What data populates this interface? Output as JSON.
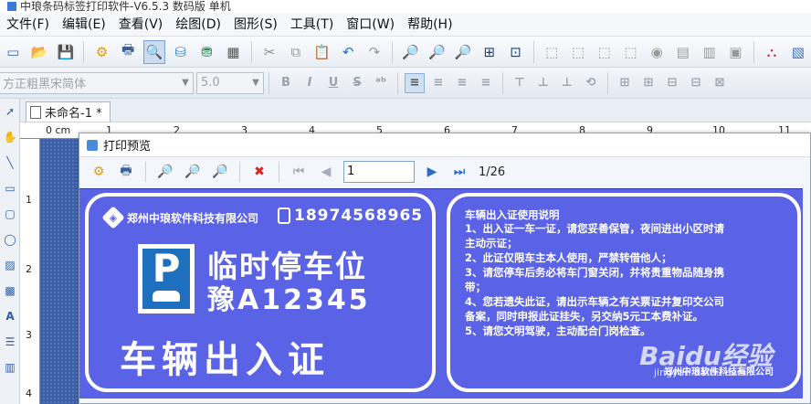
{
  "window": {
    "title": "中琅条码标签打印软件-V6.5.3 数码版 单机"
  },
  "menu": [
    {
      "label": "文件(F)"
    },
    {
      "label": "编辑(E)"
    },
    {
      "label": "查看(V)"
    },
    {
      "label": "绘图(D)"
    },
    {
      "label": "图形(S)"
    },
    {
      "label": "工具(T)"
    },
    {
      "label": "窗口(W)"
    },
    {
      "label": "帮助(H)"
    }
  ],
  "format_toolbar": {
    "font": "方正粗黑宋简体",
    "size": "5.0",
    "bold": "B",
    "italic": "I",
    "underline": "U",
    "strike": "S"
  },
  "document_tab": {
    "label": "未命名-1 *"
  },
  "ruler": {
    "top": [
      "0 cm",
      "1",
      "2",
      "3",
      "4",
      "5",
      "6",
      "7",
      "8",
      "9",
      "10",
      "11"
    ],
    "left": [
      "1",
      "2",
      "3",
      "4"
    ]
  },
  "preview": {
    "title": "打印预览",
    "page_value": "1",
    "page_total": "1/26"
  },
  "card": {
    "company": "郑州中琅软件科技有限公司",
    "phone": "18974568965",
    "parking_letter": "P",
    "line1": "临时停车位",
    "line2": "豫A12345",
    "big_title": "车辆出入证",
    "notes_title": "车辆出入证使用说明",
    "notes": [
      "1、出入证一车一证，请您妥善保管，夜间进出小区时请",
      "主动示证；",
      "2、此证仅限车主本人使用，严禁转借他人；",
      "3、请您停车后务必将车门窗关闭，并将贵重物品随身携",
      "带；",
      "4、您若遗失此证，请出示车辆之有关票证并复印交公司",
      "备案，同时申报此证挂失，另交纳5元工本费补证。",
      "5、请您文明驾驶，主动配合门岗检查。"
    ],
    "footer_company": "郑州中琅软件科技有限公司"
  },
  "watermark": {
    "text": "Baidu经验",
    "url": "jingyan.baidu.com"
  },
  "colors": {
    "card_bg": "#5a63e6",
    "canvas_bg": "#3c5fa6",
    "accent": "#1f6fbf"
  }
}
